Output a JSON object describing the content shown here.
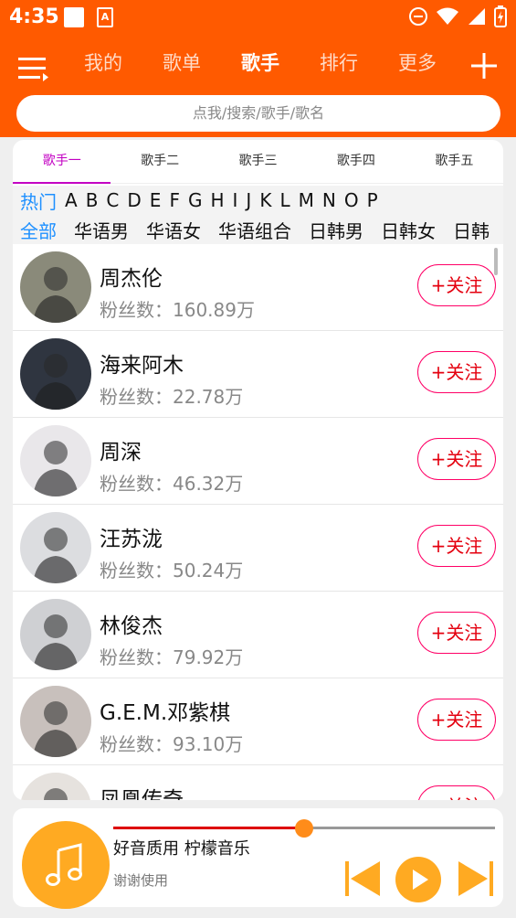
{
  "status_bar": {
    "time": "4:35",
    "icons": [
      "notification-square-icon",
      "app-a-icon",
      "dnd-icon",
      "wifi-icon",
      "signal-icon",
      "battery-charging-icon"
    ]
  },
  "header": {
    "tabs": [
      {
        "label": "我的",
        "active": false
      },
      {
        "label": "歌单",
        "active": false
      },
      {
        "label": "歌手",
        "active": true
      },
      {
        "label": "排行",
        "active": false
      },
      {
        "label": "更多",
        "active": false
      }
    ],
    "search_placeholder": "点我/搜索/歌手/歌名"
  },
  "sub_tabs": [
    {
      "label": "歌手一",
      "active": true
    },
    {
      "label": "歌手二",
      "active": false
    },
    {
      "label": "歌手三",
      "active": false
    },
    {
      "label": "歌手四",
      "active": false
    },
    {
      "label": "歌手五",
      "active": false
    }
  ],
  "letters": [
    "热门",
    "A",
    "B",
    "C",
    "D",
    "E",
    "F",
    "G",
    "H",
    "I",
    "J",
    "K",
    "L",
    "M",
    "N",
    "O",
    "P"
  ],
  "categories": [
    "全部",
    "华语男",
    "华语女",
    "华语组合",
    "日韩男",
    "日韩女",
    "日韩"
  ],
  "singers": [
    {
      "name": "周杰伦",
      "fans": "粉丝数：160.89万",
      "follow": "+关注",
      "avatar_bg": "#8a8a7a"
    },
    {
      "name": "海来阿木",
      "fans": "粉丝数：22.78万",
      "follow": "+关注",
      "avatar_bg": "#2f3540"
    },
    {
      "name": "周深",
      "fans": "粉丝数：46.32万",
      "follow": "+关注",
      "avatar_bg": "#e9e7ea"
    },
    {
      "name": "汪苏泷",
      "fans": "粉丝数：50.24万",
      "follow": "+关注",
      "avatar_bg": "#dcdde0"
    },
    {
      "name": "林俊杰",
      "fans": "粉丝数：79.92万",
      "follow": "+关注",
      "avatar_bg": "#cfd0d3"
    },
    {
      "name": "G.E.M.邓紫棋",
      "fans": "粉丝数：93.10万",
      "follow": "+关注",
      "avatar_bg": "#c8c0bc"
    },
    {
      "name": "凤凰传奇",
      "fans": "",
      "follow": "+关注",
      "avatar_bg": "#e6e2de"
    }
  ],
  "player": {
    "song": "好音质用 柠檬音乐",
    "artist": "谢谢使用",
    "progress": 0.5
  },
  "colors": {
    "brand": "#ff5a00",
    "sub_tab_active": "#c300c3",
    "filter_active": "#1e90ff",
    "follow": "#e4000f",
    "player_accent": "#ffaa22"
  }
}
